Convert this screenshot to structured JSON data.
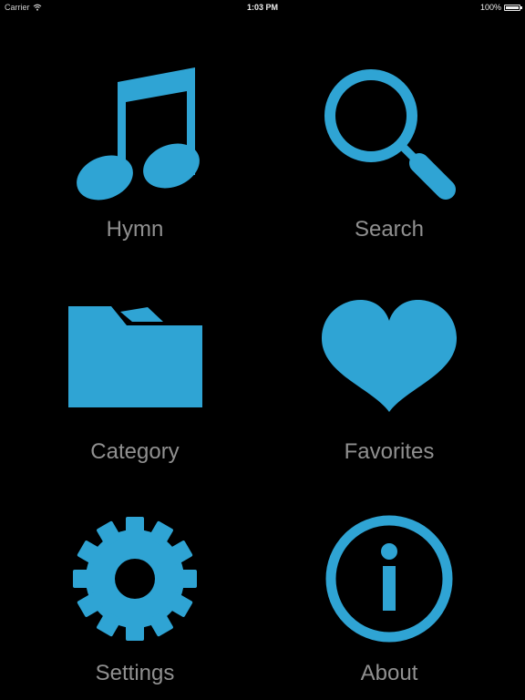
{
  "status_bar": {
    "carrier": "Carrier",
    "time": "1:03 PM",
    "battery": "100%"
  },
  "menu": {
    "accent_color": "#2fa4d4",
    "label_color": "#909090",
    "items": [
      {
        "label": "Hymn",
        "icon": "music-note-icon"
      },
      {
        "label": "Search",
        "icon": "magnifier-icon"
      },
      {
        "label": "Category",
        "icon": "folder-icon"
      },
      {
        "label": "Favorites",
        "icon": "heart-icon"
      },
      {
        "label": "Settings",
        "icon": "gear-icon"
      },
      {
        "label": "About",
        "icon": "info-icon"
      }
    ]
  }
}
